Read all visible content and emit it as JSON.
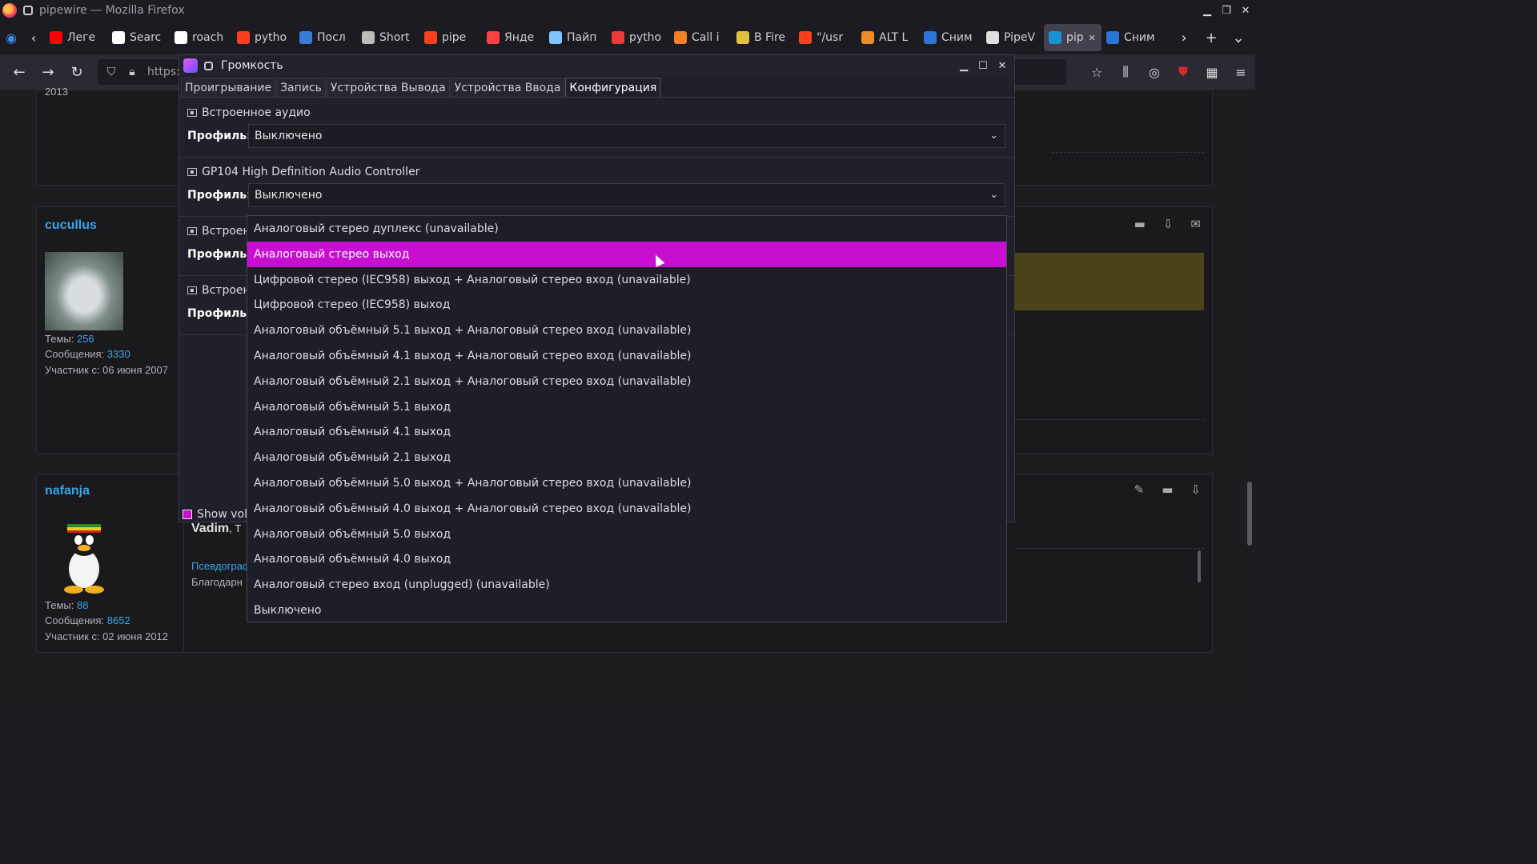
{
  "browser": {
    "window_title": "pipewire — Mozilla Firefox",
    "tabs": [
      {
        "label": "Леге",
        "icon": "youtube-icon",
        "color": "#ff0000"
      },
      {
        "label": "Searc",
        "icon": "github-icon",
        "color": "#ffffff"
      },
      {
        "label": "roach",
        "icon": "github-icon",
        "color": "#ffffff"
      },
      {
        "label": "pytho",
        "icon": "yandex-icon",
        "color": "#fc3f1d"
      },
      {
        "label": "Посл",
        "icon": "wordpress-icon",
        "color": "#3b7bd8"
      },
      {
        "label": "Short",
        "icon": "doc-icon",
        "color": "#bbbbbb"
      },
      {
        "label": "pipe",
        "icon": "yandex-icon",
        "color": "#fc3f1d"
      },
      {
        "label": "Янде",
        "icon": "translate-icon",
        "color": "#ff4040"
      },
      {
        "label": "Пайп",
        "icon": "snowflake-icon",
        "color": "#7fc4ff"
      },
      {
        "label": "pytho",
        "icon": "qa-icon",
        "color": "#e83a3a"
      },
      {
        "label": "Call i",
        "icon": "stackoverflow-icon",
        "color": "#f48024"
      },
      {
        "label": "В Fire",
        "icon": "star-doc-icon",
        "color": "#e0c040"
      },
      {
        "label": "\"/usr",
        "icon": "yandex-icon",
        "color": "#fc3f1d"
      },
      {
        "label": "ALT L",
        "icon": "alt-icon",
        "color": "#f08a24"
      },
      {
        "label": "Сним",
        "icon": "p-icon",
        "color": "#2c74d6"
      },
      {
        "label": "PipeV",
        "icon": "figure-icon",
        "color": "#e0e0e0"
      },
      {
        "label": "pip",
        "icon": "arch-icon",
        "color": "#1793d1",
        "active": true
      },
      {
        "label": "Сним",
        "icon": "p-icon",
        "color": "#2c74d6"
      }
    ],
    "url_text": "https:"
  },
  "forum": {
    "year_text": "2013",
    "posts": [
      {
        "username": "cucullus",
        "topics_label": "Темы:",
        "topics": "256",
        "messages_label": "Сообщения:",
        "messages": "3330",
        "member_since": "Участник с: 06 июня 2007"
      },
      {
        "username": "nafanja",
        "topics_label": "Темы:",
        "topics": "88",
        "messages_label": "Сообщения:",
        "messages": "8652",
        "member_since": "Участник с: 02 июня 2012",
        "reply_author": "Vadim",
        "reply_author_suffix": ", Т",
        "link_text": "Псевдограф",
        "body_text": "Благодарн"
      }
    ]
  },
  "volume_window": {
    "title": "Громкость",
    "tabs": [
      "Проигрывание",
      "Запись",
      "Устройства Вывода",
      "Устройства Ввода",
      "Конфигурация"
    ],
    "active_tab": "Конфигурация",
    "profile_label": "Профиль:",
    "cards": [
      {
        "name": "Встроенное аудио",
        "profile": "Выключено"
      },
      {
        "name": "GP104 High Definition Audio Controller",
        "profile": "Выключено"
      },
      {
        "name": "Встроен",
        "profile": ""
      },
      {
        "name": "Встроен",
        "profile": ""
      }
    ],
    "show_volume_label": "Show volu"
  },
  "dropdown": {
    "selected": "Аналоговый стерео выход",
    "options": [
      "Аналоговый стерео дуплекс (unavailable)",
      "Аналоговый стерео выход",
      "Цифровой стерео (IEC958) выход + Аналоговый стерео вход (unavailable)",
      "Цифровой стерео (IEC958) выход",
      "Аналоговый объёмный 5.1 выход + Аналоговый стерео вход (unavailable)",
      "Аналоговый объёмный 4.1 выход + Аналоговый стерео вход (unavailable)",
      "Аналоговый объёмный 2.1 выход + Аналоговый стерео вход (unavailable)",
      "Аналоговый объёмный 5.1 выход",
      "Аналоговый объёмный 4.1 выход",
      "Аналоговый объёмный 2.1 выход",
      "Аналоговый объёмный 5.0 выход + Аналоговый стерео вход (unavailable)",
      "Аналоговый объёмный 4.0 выход + Аналоговый стерео вход (unavailable)",
      "Аналоговый объёмный 5.0 выход",
      "Аналоговый объёмный 4.0 выход",
      "Аналоговый стерео вход (unplugged) (unavailable)",
      "Выключено"
    ]
  },
  "colors": {
    "accent": "#c80ed1",
    "link": "#37a4e8"
  }
}
